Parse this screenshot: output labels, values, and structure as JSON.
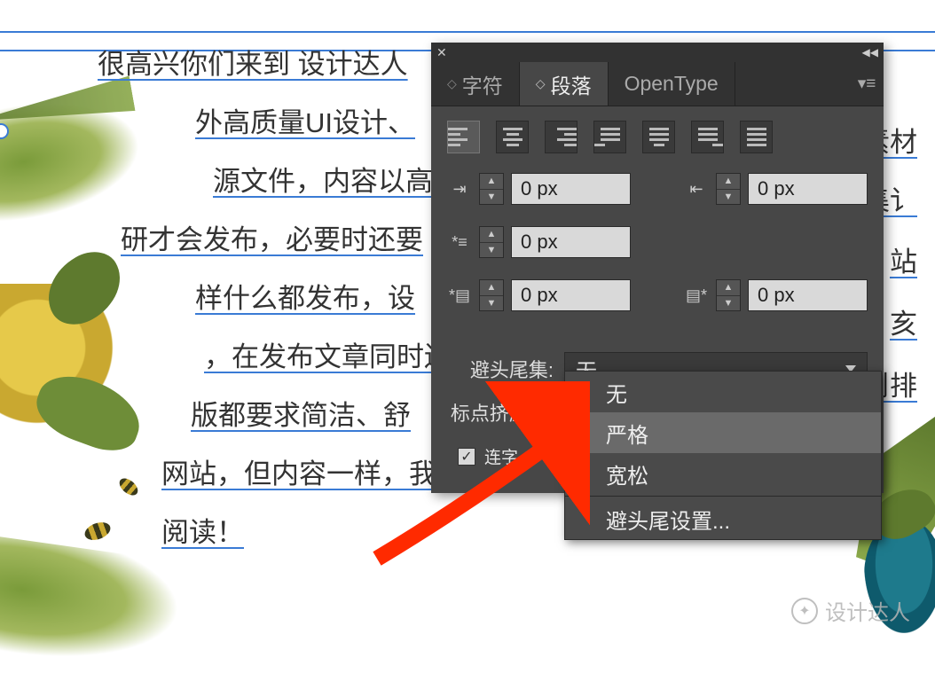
{
  "document": {
    "lines": {
      "l1": "很高兴你们来到 设计达人",
      "l2": "外高质量UI设计、",
      "l3": "源文件，内容以高",
      "l4": "研才会发布，必要时还要",
      "l5": "样什么都发布，设",
      "l6": "，在发布文章同时还",
      "l7": "版都要求简洁、舒",
      "l8": "网站，但内容一样，我相信你会更",
      "l9": "阅读！",
      "r1": "素材",
      "r2": "集讠",
      "r3": "站",
      "r4": "亥",
      "r5": "刂排"
    }
  },
  "panel": {
    "tabs": {
      "char": "字符",
      "paragraph": "段落",
      "opentype": "OpenType"
    },
    "indent": {
      "left": {
        "value": "0 px"
      },
      "right": {
        "value": "0 px"
      },
      "firstline": {
        "value": "0 px"
      },
      "spacebefore": {
        "value": "0 px"
      },
      "spaceafter": {
        "value": "0 px"
      }
    },
    "kinsoku": {
      "label": "避头尾集:",
      "value": "无",
      "options": {
        "none": "无",
        "strict": "严格",
        "loose": "宽松",
        "settings": "避头尾设置..."
      }
    },
    "mojikumi": {
      "label": "标点挤压集:"
    },
    "ligatures": {
      "label": "连字",
      "checked": true
    }
  },
  "watermark": {
    "text": "设计达人"
  }
}
